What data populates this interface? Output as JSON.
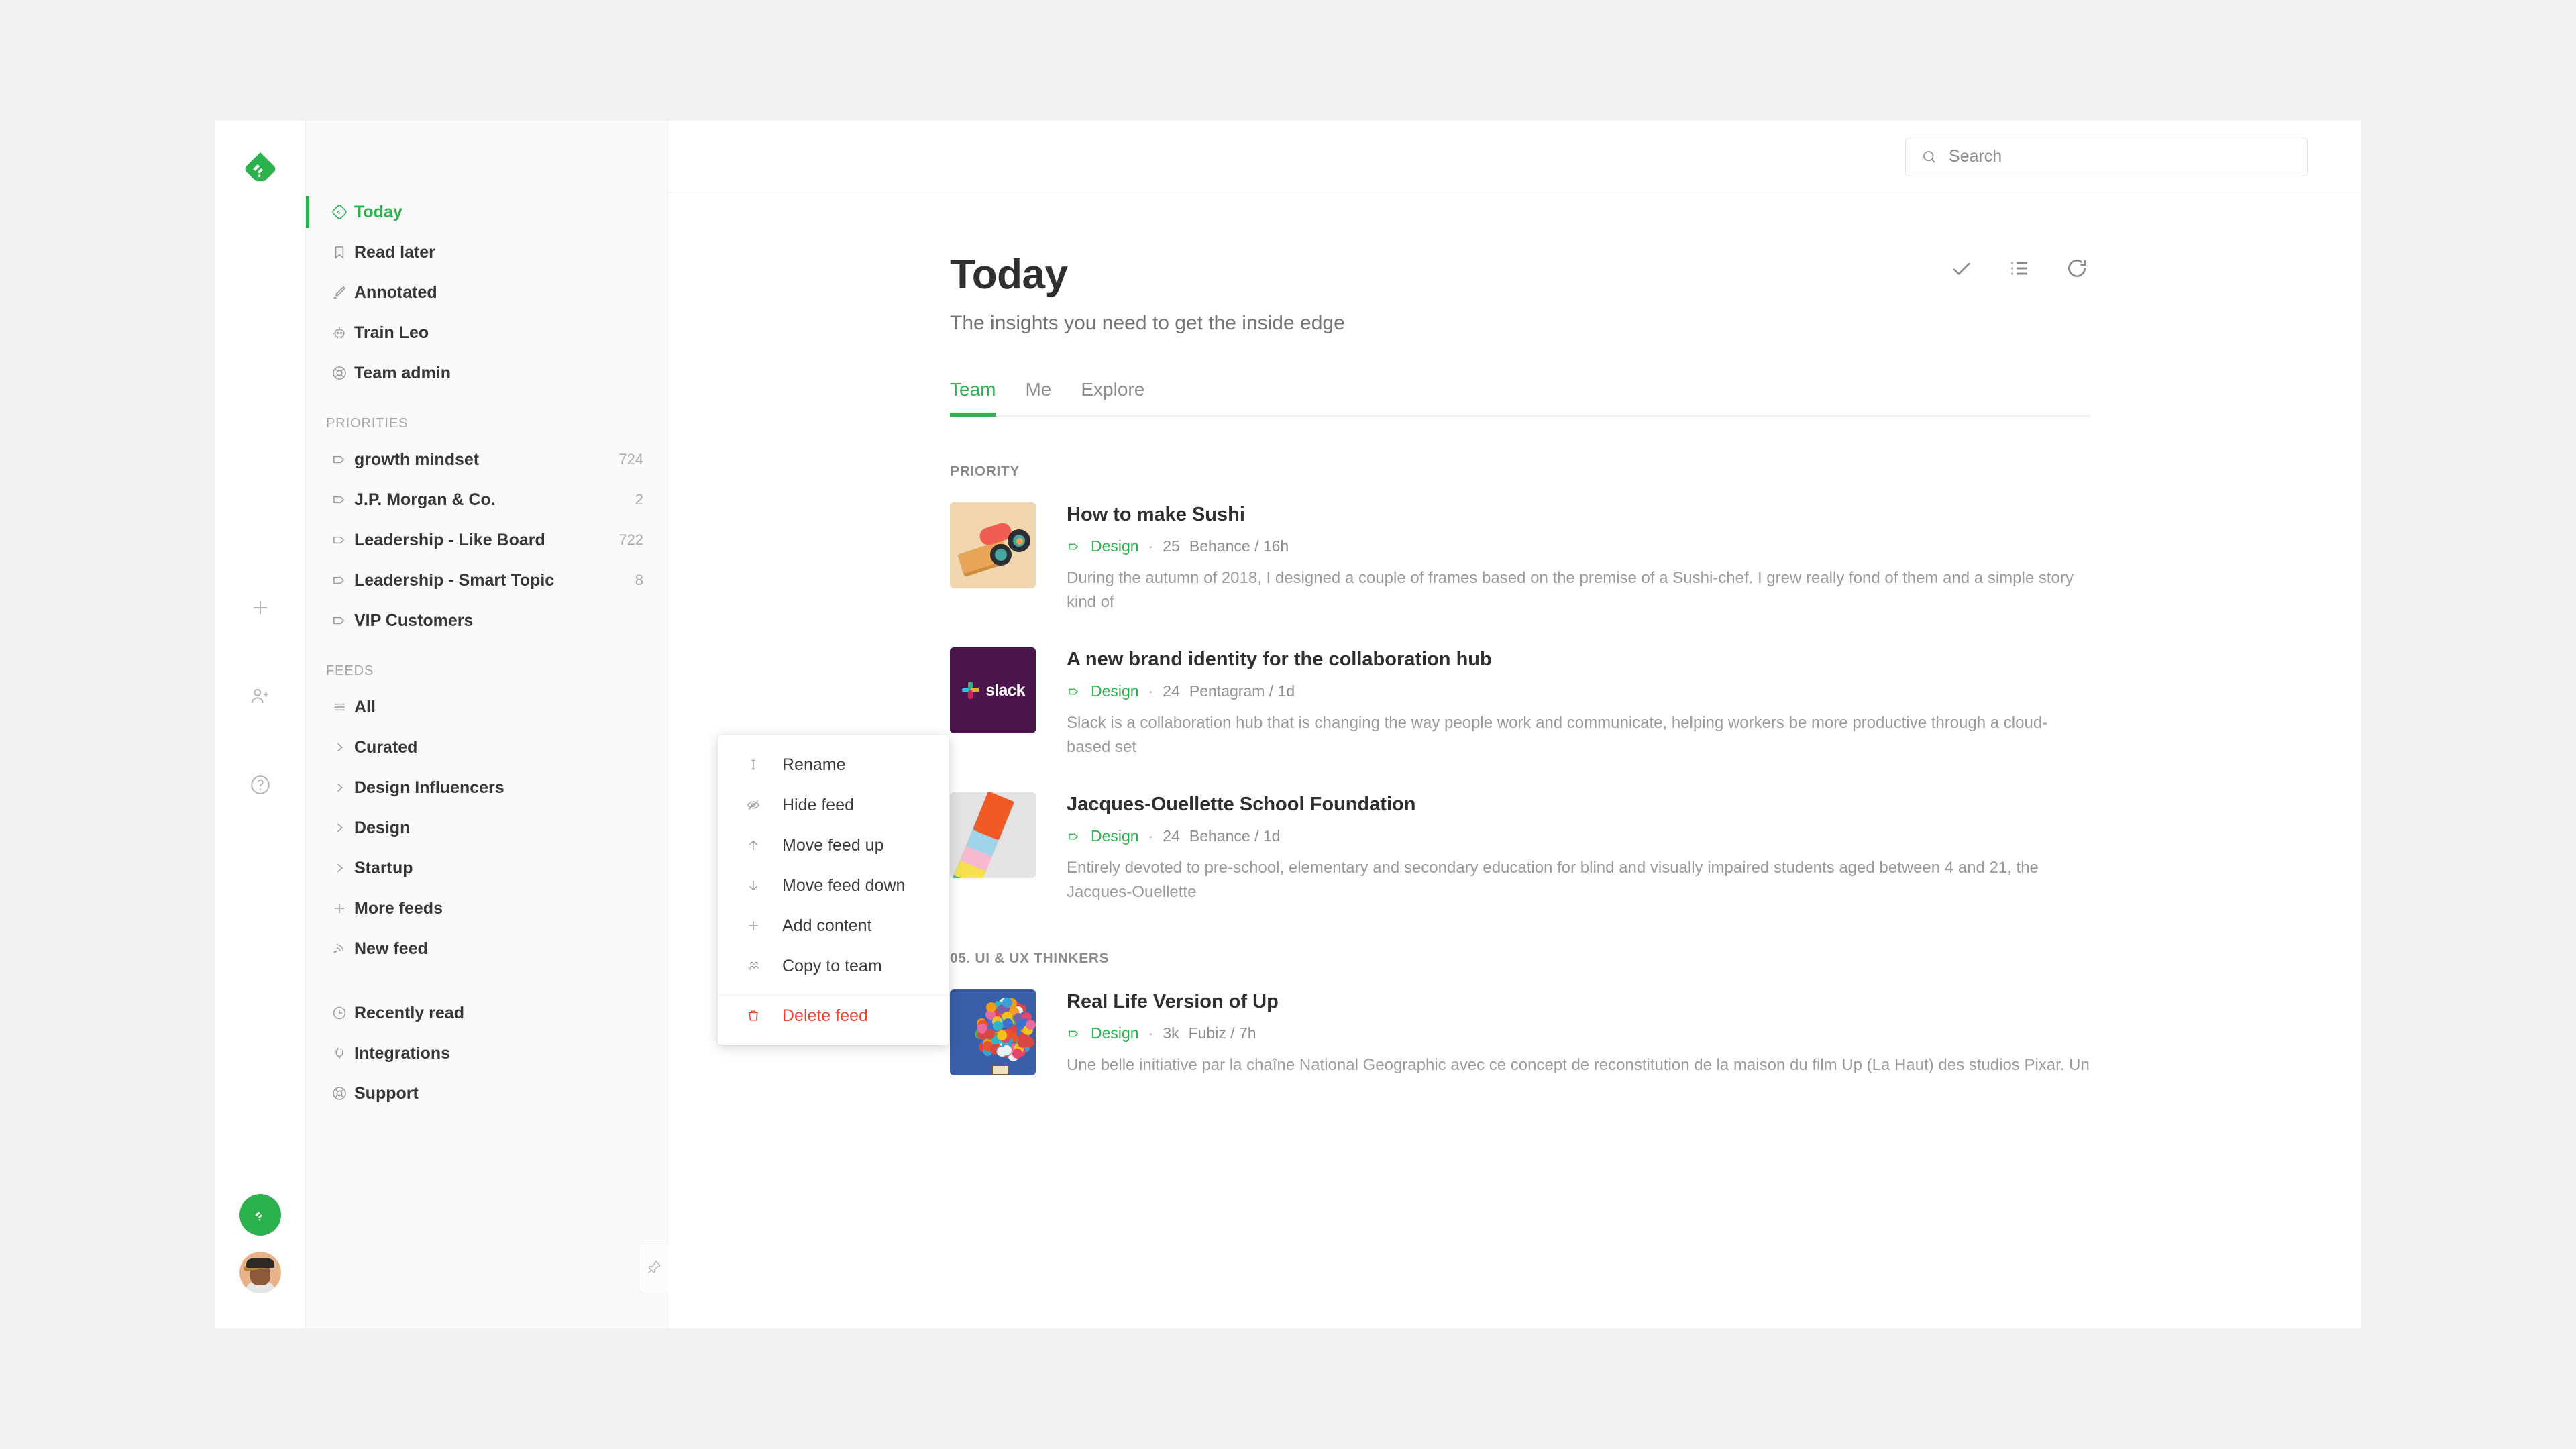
{
  "app": {
    "name": "Feedly"
  },
  "rail": {
    "logo_icon": "feedly-logo-icon",
    "icons": [
      {
        "name": "add-content-icon",
        "label": "Add content"
      },
      {
        "name": "invite-user-icon",
        "label": "Invite teammate"
      },
      {
        "name": "help-circle-icon",
        "label": "Help"
      }
    ],
    "badge_icon": "feedly-badge-icon",
    "avatar_name": "user-avatar"
  },
  "sidebar": {
    "primary": [
      {
        "label": "Today",
        "icon": "feedly-today-icon",
        "active": true
      },
      {
        "label": "Read later",
        "icon": "bookmark-icon",
        "active": false
      },
      {
        "label": "Annotated",
        "icon": "highlighter-icon",
        "active": false
      },
      {
        "label": "Train Leo",
        "icon": "robot-icon",
        "active": false
      },
      {
        "label": "Team admin",
        "icon": "lifebuoy-icon",
        "active": false
      }
    ],
    "priorities_header": "PRIORITIES",
    "priorities": [
      {
        "label": "growth mindset",
        "count": "724",
        "icon": "tag-icon"
      },
      {
        "label": "J.P. Morgan & Co.",
        "count": "2",
        "icon": "tag-icon"
      },
      {
        "label": "Leadership - Like Board",
        "count": "722",
        "icon": "tag-icon"
      },
      {
        "label": "Leadership - Smart Topic",
        "count": "8",
        "icon": "tag-icon"
      },
      {
        "label": "VIP Customers",
        "count": "",
        "icon": "tag-icon"
      }
    ],
    "feeds_header": "FEEDS",
    "feeds": [
      {
        "label": "All",
        "icon": "list-lines-icon"
      },
      {
        "label": "Curated",
        "icon": "chevron-right-icon"
      },
      {
        "label": "Design Influencers",
        "icon": "chevron-right-icon"
      },
      {
        "label": "Design",
        "icon": "chevron-right-icon"
      },
      {
        "label": "Startup",
        "icon": "chevron-right-icon"
      },
      {
        "label": "More feeds",
        "icon": "plus-icon"
      },
      {
        "label": "New feed",
        "icon": "rss-add-icon"
      }
    ],
    "footer": [
      {
        "label": "Recently read",
        "icon": "clock-icon"
      },
      {
        "label": "Integrations",
        "icon": "plug-icon"
      },
      {
        "label": "Support",
        "icon": "lifebuoy-icon"
      }
    ],
    "pin_icon": "pin-icon"
  },
  "search": {
    "placeholder": "Search",
    "value": "",
    "icon": "search-icon"
  },
  "header": {
    "title": "Today",
    "subtitle": "The insights you need to get the inside edge",
    "actions": [
      {
        "name": "mark-all-read-button",
        "icon": "check-icon"
      },
      {
        "name": "view-mode-button",
        "icon": "list-icon"
      },
      {
        "name": "refresh-button",
        "icon": "refresh-icon"
      }
    ],
    "tabs": [
      {
        "label": "Team",
        "active": true
      },
      {
        "label": "Me",
        "active": false
      },
      {
        "label": "Explore",
        "active": false
      }
    ]
  },
  "groups": [
    {
      "heading": "PRIORITY",
      "articles": [
        {
          "title": "How to make Sushi",
          "tag": "Design",
          "count": "25",
          "source": "Behance / 16h",
          "snippet": "During the autumn of 2018, I designed a couple of frames based on the premise of a Sushi-chef. I grew really fond of them and a simple story kind of",
          "thumb": "sushi-thumbnail"
        },
        {
          "title": "A new brand identity for the collaboration hub",
          "tag": "Design",
          "count": "24",
          "source": "Pentagram / 1d",
          "snippet": "Slack is a collaboration hub that is changing the way people work and communicate, helping workers be more productive through a cloud-based set",
          "thumb": "slack-thumbnail"
        },
        {
          "title": "Jacques-Ouellette School Foundation",
          "tag": "Design",
          "count": "24",
          "source": "Behance / 1d",
          "snippet": "Entirely devoted to pre-school, elementary and secondary education for blind and visually impaired students aged between 4 and 21, the Jacques-Ouellette",
          "thumb": "cards-thumbnail"
        }
      ]
    },
    {
      "heading": "05. UI & UX THINKERS",
      "articles": [
        {
          "title": "Real Life Version of Up",
          "tag": "Design",
          "count": "3k",
          "source": "Fubiz / 7h",
          "snippet": "Une belle initiative par la chaîne National Geographic avec ce concept de reconstitution de la maison du film Up (La Haut) des studios Pixar. Un",
          "thumb": "up-balloons-thumbnail"
        }
      ]
    }
  ],
  "context_menu": {
    "items": [
      {
        "label": "Rename",
        "icon": "text-cursor-icon",
        "danger": false
      },
      {
        "label": "Hide feed",
        "icon": "eye-off-icon",
        "danger": false
      },
      {
        "label": "Move feed up",
        "icon": "arrow-up-icon",
        "danger": false
      },
      {
        "label": "Move feed down",
        "icon": "arrow-down-icon",
        "danger": false
      },
      {
        "label": "Add content",
        "icon": "plus-icon",
        "danger": false
      },
      {
        "label": "Copy to team",
        "icon": "copy-team-icon",
        "danger": false
      }
    ],
    "danger_item": {
      "label": "Delete feed",
      "icon": "trash-icon"
    }
  },
  "colors": {
    "accent_green": "#2bb24c",
    "danger_red": "#f0432e",
    "page_bg": "#f1f1f1",
    "sidebar_bg": "#fafafa",
    "slack_purple": "#4a154b"
  }
}
